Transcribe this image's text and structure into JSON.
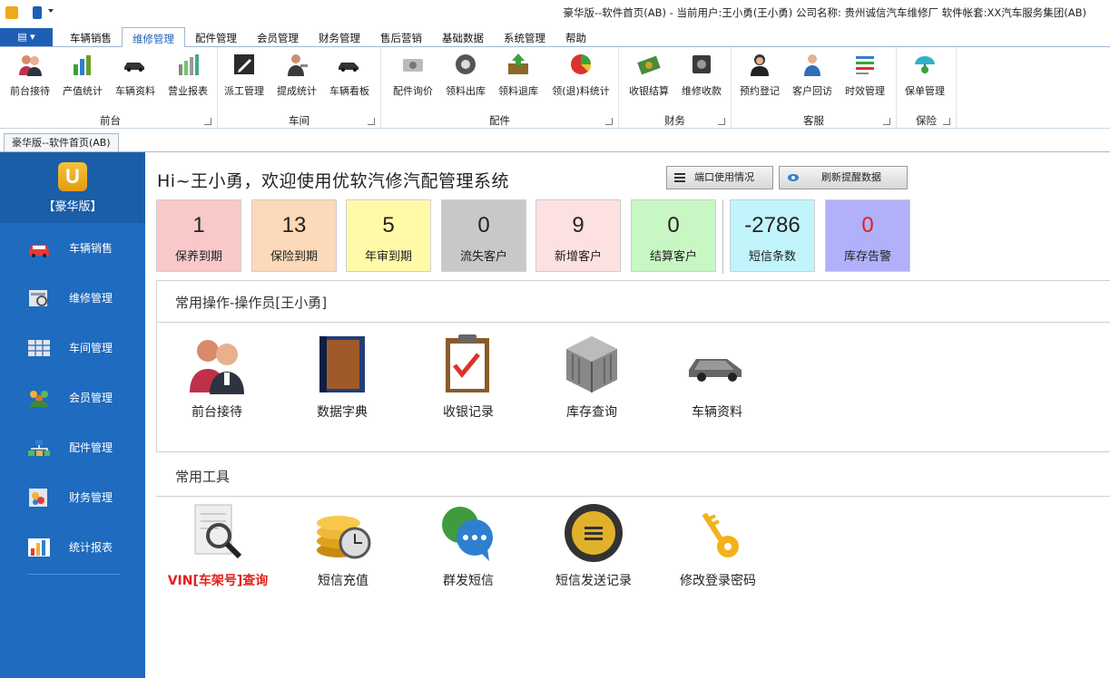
{
  "window": {
    "title": "豪华版--软件首页(AB) - 当前用户:王小勇(王小勇) 公司名称: 贵州诚信汽车维修厂 软件帐套:XX汽车服务集团(AB)"
  },
  "menu": {
    "app_button": "▤ ▾",
    "tabs": [
      "车辆销售",
      "维修管理",
      "配件管理",
      "会员管理",
      "财务管理",
      "售后营销",
      "基础数据",
      "系统管理",
      "帮助"
    ],
    "active_tab": "维修管理"
  },
  "ribbon": {
    "groups": [
      {
        "label": "前台",
        "items": [
          {
            "label": "前台接待",
            "icon": "people-icon"
          },
          {
            "label": "产值统计",
            "icon": "bar-chart-icon"
          },
          {
            "label": "车辆资料",
            "icon": "car-icon"
          },
          {
            "label": "营业报表",
            "icon": "report-icon"
          }
        ]
      },
      {
        "label": "车间",
        "items": [
          {
            "label": "派工管理",
            "icon": "pen-icon"
          },
          {
            "label": "提成统计",
            "icon": "worker-icon"
          },
          {
            "label": "车辆看板",
            "icon": "car-icon"
          }
        ]
      },
      {
        "label": "配件",
        "items": [
          {
            "label": "配件询价",
            "icon": "printer-icon"
          },
          {
            "label": "领料出库",
            "icon": "gear-icon"
          },
          {
            "label": "领料退库",
            "icon": "box-icon"
          },
          {
            "label": "领(退)料统计",
            "icon": "pie-chart-icon"
          }
        ]
      },
      {
        "label": "财务",
        "items": [
          {
            "label": "收银结算",
            "icon": "money-icon"
          },
          {
            "label": "维修收款",
            "icon": "safe-icon"
          }
        ]
      },
      {
        "label": "客服",
        "items": [
          {
            "label": "预约登记",
            "icon": "agent-icon"
          },
          {
            "label": "客户回访",
            "icon": "person-icon"
          },
          {
            "label": "时效管理",
            "icon": "list-icon"
          }
        ]
      },
      {
        "label": "保险",
        "items": [
          {
            "label": "保单管理",
            "icon": "umbrella-icon"
          }
        ]
      }
    ]
  },
  "doc_tab": "豪华版--软件首页(AB)",
  "sidebar": {
    "logo_letter": "U",
    "brand": "【豪华版】",
    "items": [
      {
        "label": "车辆销售",
        "icon": "car-icon"
      },
      {
        "label": "维修管理",
        "icon": "repair-icon"
      },
      {
        "label": "车间管理",
        "icon": "grid-icon"
      },
      {
        "label": "会员管理",
        "icon": "members-icon"
      },
      {
        "label": "配件管理",
        "icon": "blocks-icon"
      },
      {
        "label": "财务管理",
        "icon": "finance-icon"
      },
      {
        "label": "统计报表",
        "icon": "bar-chart-icon"
      }
    ]
  },
  "main": {
    "welcome": "Hi~王小勇，欢迎使用优软汽修汽配管理系统",
    "port_button": "端口使用情况",
    "refresh_button": "刷新提醒数据",
    "stats": [
      {
        "value": "1",
        "label": "保养到期",
        "bg": "#f9c9c9",
        "color": "#222"
      },
      {
        "value": "13",
        "label": "保险到期",
        "bg": "#fcd9b8",
        "color": "#222"
      },
      {
        "value": "5",
        "label": "年审到期",
        "bg": "#fffaa8",
        "color": "#222"
      },
      {
        "value": "0",
        "label": "流失客户",
        "bg": "#c8c8c8",
        "color": "#222"
      },
      {
        "value": "9",
        "label": "新增客户",
        "bg": "#fde1e1",
        "color": "#222"
      },
      {
        "value": "0",
        "label": "结算客户",
        "bg": "#c9f7c4",
        "color": "#222"
      },
      {
        "value": "-2786",
        "label": "短信条数",
        "bg": "#c2f4fb",
        "color": "#222"
      },
      {
        "value": "0",
        "label": "库存告警",
        "bg": "#b0b0fb",
        "color": "#e0211c"
      }
    ],
    "common_ops": {
      "title": "常用操作-操作员[王小勇]",
      "items": [
        {
          "label": "前台接待",
          "icon": "people-icon"
        },
        {
          "label": "数据字典",
          "icon": "book-icon"
        },
        {
          "label": "收银记录",
          "icon": "checklist-icon"
        },
        {
          "label": "库存查询",
          "icon": "cube-icon"
        },
        {
          "label": "车辆资料",
          "icon": "car-icon"
        }
      ]
    },
    "common_tools": {
      "title": "常用工具",
      "items": [
        {
          "label": "VIN[车架号]查询",
          "icon": "magnifier-doc-icon",
          "highlight": true
        },
        {
          "label": "短信充值",
          "icon": "coins-clock-icon"
        },
        {
          "label": "群发短信",
          "icon": "chat-bubbles-icon"
        },
        {
          "label": "短信发送记录",
          "icon": "message-log-icon"
        },
        {
          "label": "修改登录密码",
          "icon": "key-icon"
        }
      ]
    }
  }
}
